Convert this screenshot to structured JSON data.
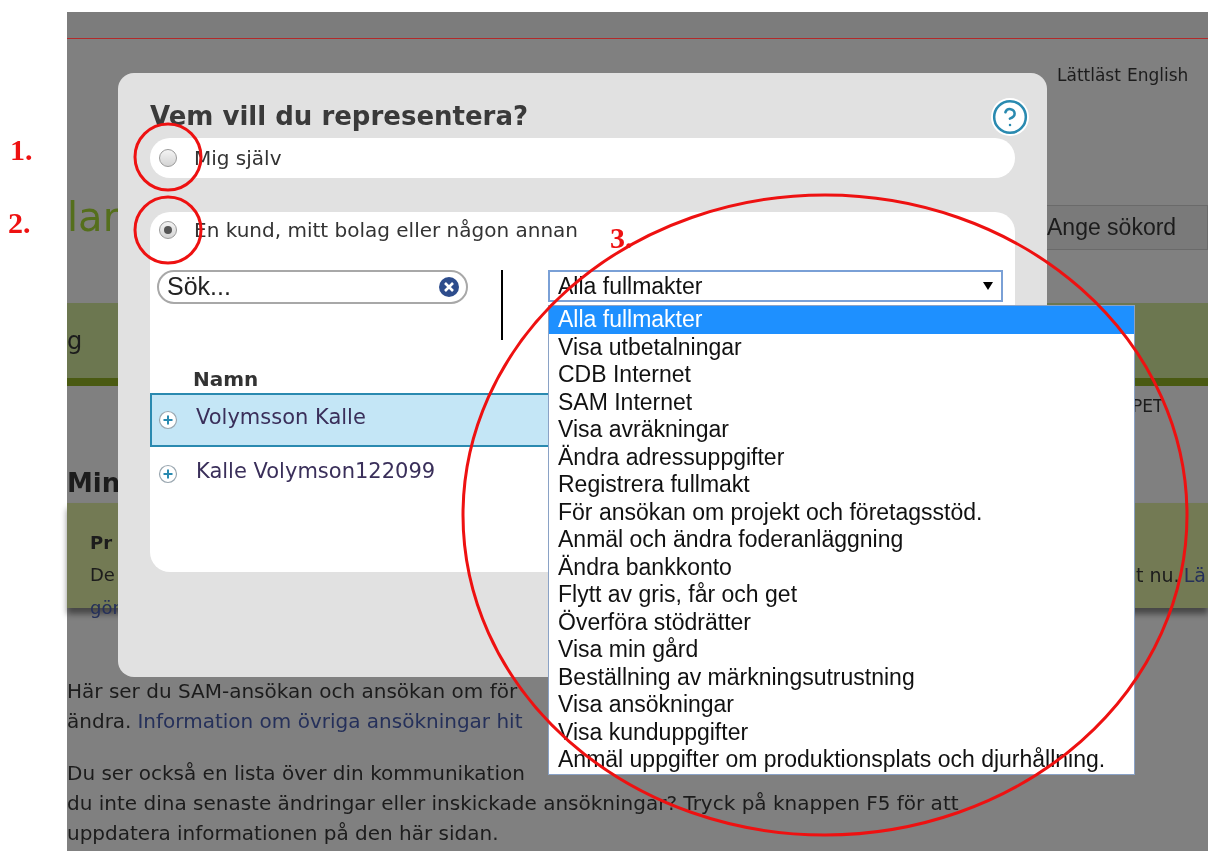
{
  "page": {
    "top_links": [
      {
        "label": "Lättläst"
      },
      {
        "label": "English"
      }
    ],
    "heading_fragment": "lar",
    "search": {
      "placeholder": "Ange sökord"
    },
    "nav_fragment": "g",
    "user_fragment": "PET",
    "section_heading": "Min",
    "notice": {
      "title": "Pr",
      "text_start": "De",
      "link_start": "gör",
      "text_end": "t nu.",
      "link_end": "Lä"
    },
    "paragraphs": [
      {
        "lines": [
          [
            {
              "text": "Här ser du SAM-ansökan och ansökan om för",
              "link": false
            }
          ],
          [
            {
              "text": "ändra.",
              "link": false
            },
            {
              "text": "Information om övriga ansökningar hit",
              "link": true
            }
          ]
        ]
      },
      {
        "lines": [
          [
            {
              "text": "Du ser också en lista över din kommunikation",
              "link": false
            }
          ],
          [
            {
              "text": "du inte dina senaste ändringar eller inskickade ansökningar? Tryck på knappen F5 för att",
              "link": false
            }
          ],
          [
            {
              "text": "uppdatera informationen på den här sidan.",
              "link": false
            }
          ]
        ]
      }
    ]
  },
  "dialog": {
    "title": "Vem vill du representera?",
    "options": [
      {
        "label": "Mig själv",
        "selected": false
      },
      {
        "label": "En kund, mitt bolag eller någon annan",
        "selected": true
      }
    ],
    "search": {
      "placeholder": "Sök..."
    },
    "filter": {
      "value": "Alla fullmakter",
      "expanded": true,
      "options": [
        {
          "label": "Alla fullmakter",
          "selected": true
        },
        {
          "label": "Visa utbetalningar",
          "selected": false
        },
        {
          "label": "CDB Internet",
          "selected": false
        },
        {
          "label": "SAM Internet",
          "selected": false
        },
        {
          "label": "Visa avräkningar",
          "selected": false
        },
        {
          "label": "Ändra adressuppgifter",
          "selected": false
        },
        {
          "label": "Registrera fullmakt",
          "selected": false
        },
        {
          "label": "För ansökan om projekt och företagsstöd.",
          "selected": false
        },
        {
          "label": "Anmäl och ändra foderanläggning",
          "selected": false
        },
        {
          "label": "Ändra bankkonto",
          "selected": false
        },
        {
          "label": "Flytt av gris, får och get",
          "selected": false
        },
        {
          "label": "Överföra stödrätter",
          "selected": false
        },
        {
          "label": "Visa min gård",
          "selected": false
        },
        {
          "label": "Beställning av märkningsutrustning",
          "selected": false
        },
        {
          "label": "Visa ansökningar",
          "selected": false
        },
        {
          "label": "Visa kunduppgifter",
          "selected": false
        },
        {
          "label": "Anmäl uppgifter om produktionsplats och djurhållning.",
          "selected": false
        }
      ]
    },
    "table": {
      "columns": [
        "Namn"
      ],
      "rows": [
        {
          "name": "Volymsson Kalle",
          "selected": true
        },
        {
          "name": "Kalle Volymson122099",
          "selected": false
        }
      ]
    }
  },
  "annotations": [
    {
      "label": "1."
    },
    {
      "label": "2."
    },
    {
      "label": "3."
    }
  ]
}
